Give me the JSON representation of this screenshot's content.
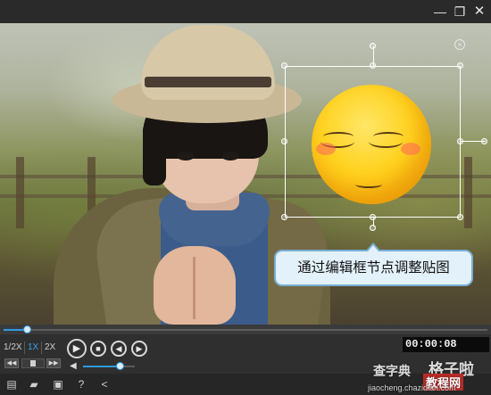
{
  "titlebar": {
    "minimize_icon": "minimize-icon",
    "restore_icon": "restore-icon",
    "close_icon": "close-icon"
  },
  "overlay": {
    "callout_text": "通过编辑框节点调整贴图",
    "sticker": "sleepy-blushing-emoji"
  },
  "playback": {
    "progress": 0.05,
    "speeds": [
      "1/2X",
      "1X",
      "2X"
    ],
    "active_speed": "1X",
    "timecode": "00:00:08",
    "volume": 0.72
  },
  "toolbar": {
    "tools": [
      "open-file-icon",
      "folder-icon",
      "save-icon",
      "help-icon",
      "share-icon"
    ]
  },
  "watermarks": {
    "w1": "查字典",
    "w2": "格子啦",
    "w3": "教程网",
    "w4": "jiaocheng.chazidian.com"
  },
  "colors": {
    "accent": "#2f9be6",
    "callout_border": "#79aed6",
    "callout_fill": "#e3f1fa"
  }
}
